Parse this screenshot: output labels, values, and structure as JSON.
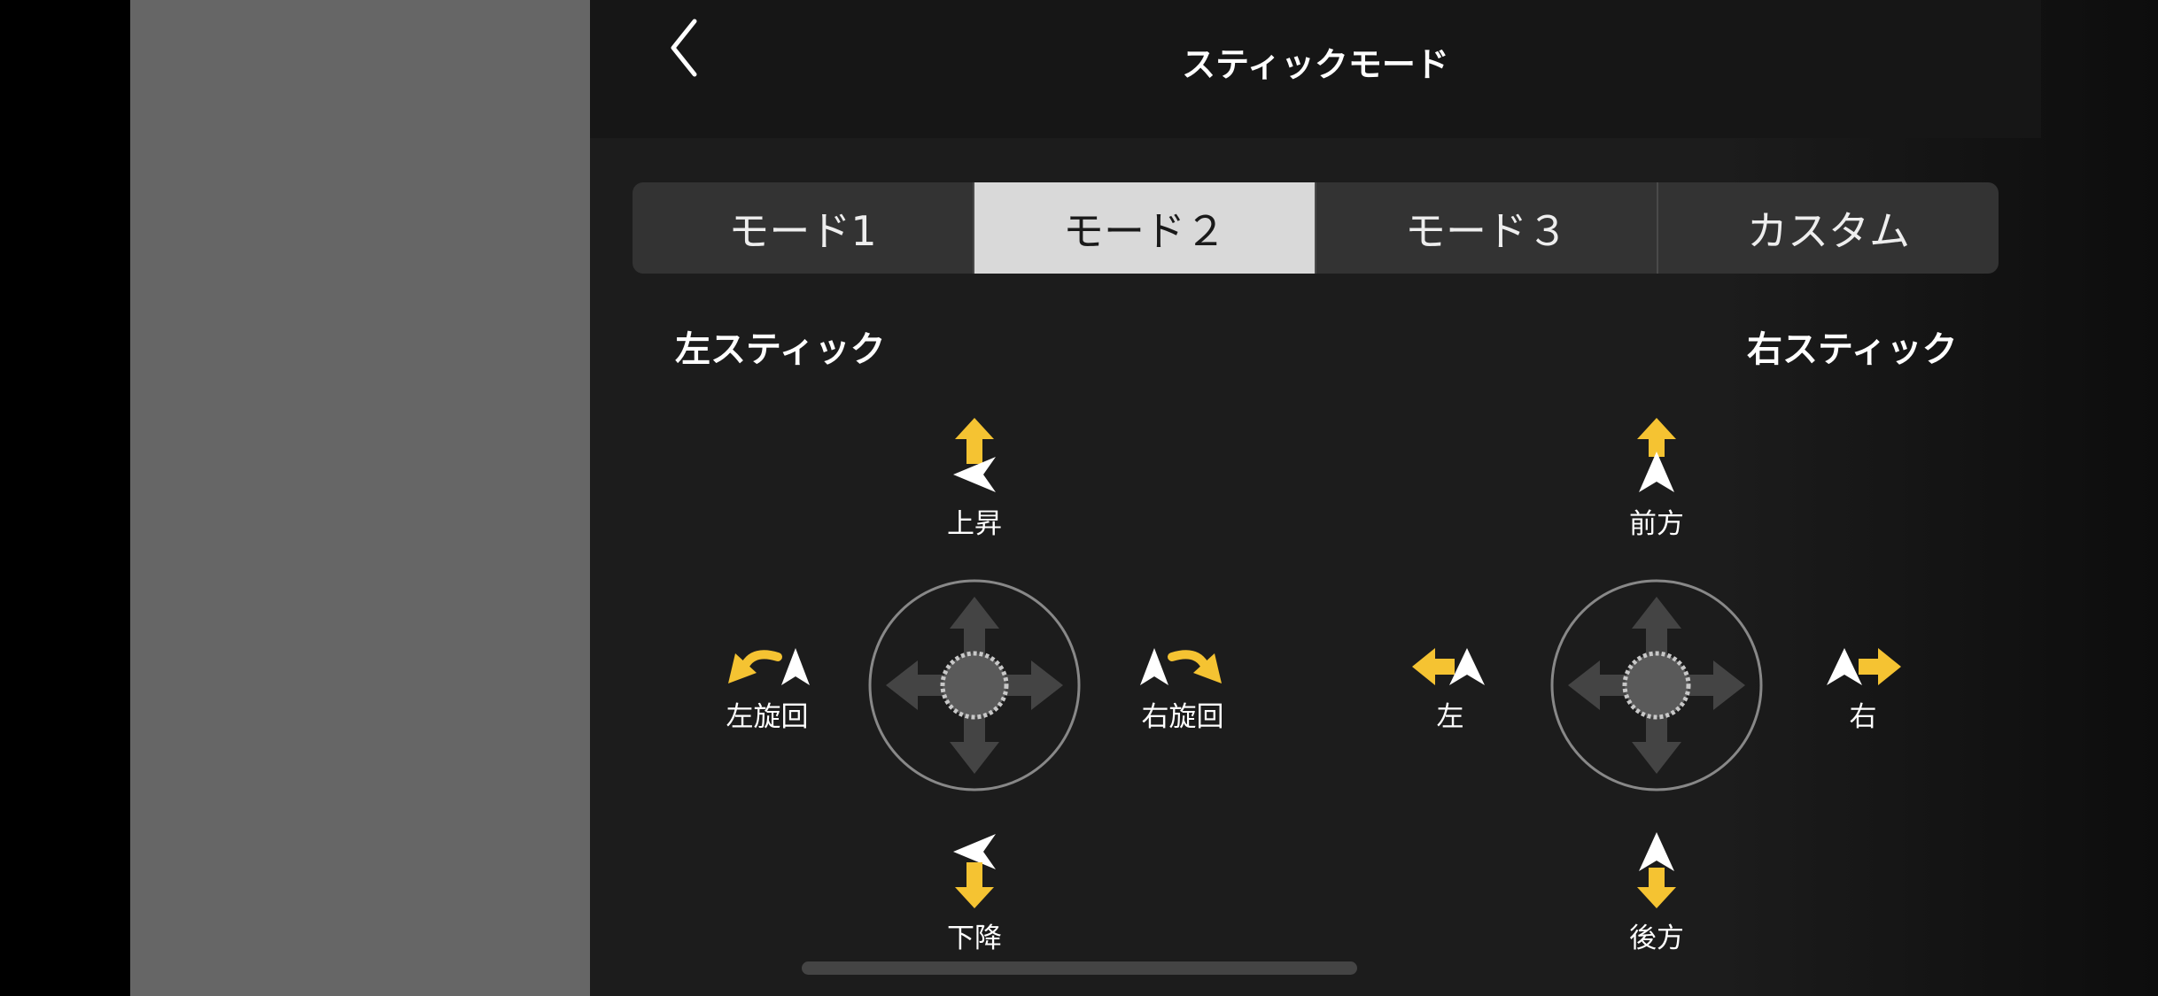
{
  "header": {
    "title": "スティックモード",
    "back_icon": "chevron-left-icon"
  },
  "mode_tabs": [
    {
      "label": "モード1",
      "selected": false
    },
    {
      "label": "モード２",
      "selected": true
    },
    {
      "label": "モード３",
      "selected": false
    },
    {
      "label": "カスタム",
      "selected": false
    }
  ],
  "left_stick": {
    "title": "左スティック",
    "up": {
      "label": "上昇",
      "icon": "ascend-icon"
    },
    "down": {
      "label": "下降",
      "icon": "descend-icon"
    },
    "left": {
      "label": "左旋回",
      "icon": "rotate-left-icon"
    },
    "right": {
      "label": "右旋回",
      "icon": "rotate-right-icon"
    }
  },
  "right_stick": {
    "title": "右スティック",
    "up": {
      "label": "前方",
      "icon": "forward-icon"
    },
    "down": {
      "label": "後方",
      "icon": "backward-icon"
    },
    "left": {
      "label": "左",
      "icon": "move-left-icon"
    },
    "right": {
      "label": "右",
      "icon": "move-right-icon"
    }
  },
  "colors": {
    "accent_yellow": "#f5c332",
    "selected_tab": "#d9d9d9",
    "background": "#1c1c1c"
  }
}
